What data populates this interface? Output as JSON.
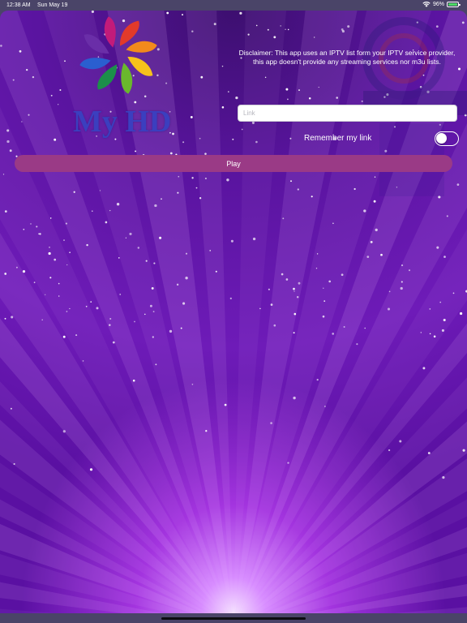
{
  "status_bar": {
    "time": "12:38 AM",
    "date": "Sun May 19",
    "battery_percent": "96%",
    "battery_level": 0.96,
    "icons": [
      "wifi-icon",
      "battery-icon"
    ]
  },
  "logo": {
    "text": "My HD",
    "icon": "flower-logo-icon"
  },
  "disclaimer": "Disclaimer: This app uses an IPTV list form your IPTV service provider, this app doesn't provide any streaming services nor m3u lists.",
  "link_field": {
    "placeholder": "Link",
    "value": ""
  },
  "remember": {
    "label": "Remember my link",
    "enabled": false
  },
  "play_button": {
    "label": "Play"
  },
  "colors": {
    "play_button": "#9a3a86",
    "logo_text": "#3b3fbf",
    "background_top": "#3d0f70",
    "background_glow": "#f6e4ff"
  }
}
